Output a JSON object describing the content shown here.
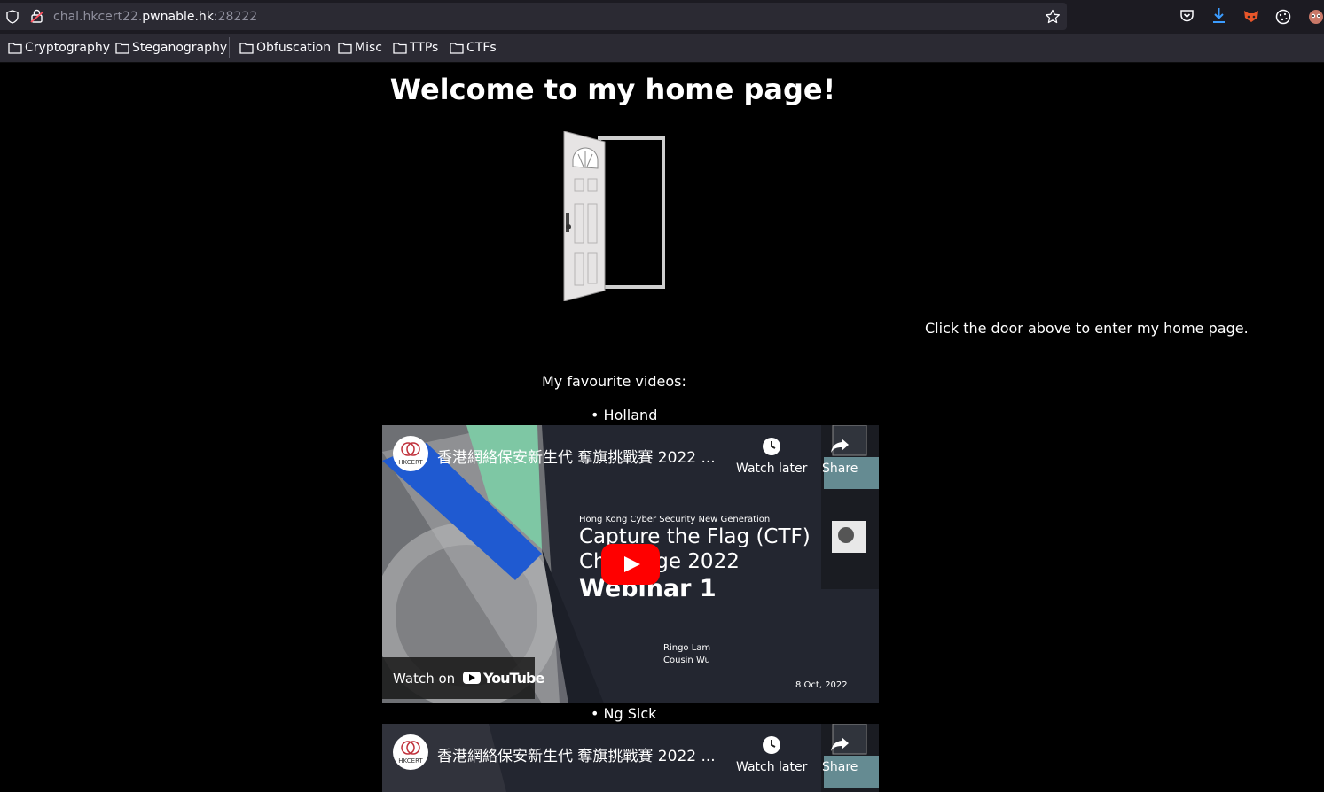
{
  "browser": {
    "url_prefix": "chal.hkcert22.",
    "url_host": "pwnable.hk",
    "url_port": ":28222",
    "bookmarks": [
      "Cryptography",
      "Steganography",
      "Obfuscation",
      "Misc",
      "TTPs",
      "CTFs"
    ]
  },
  "page": {
    "heading": "Welcome to my home page!",
    "door_caption": "Click the door above to enter my home page.",
    "favourites_label": "My favourite videos:",
    "videos": [
      {
        "bullet": "Holland",
        "title": "香港網絡保安新生代 奪旗挑戰賽 2022 ...",
        "channel_logo": "HKCERT",
        "watch_later": "Watch later",
        "share": "Share",
        "thumb_small": "Hong Kong Cyber Security New Generation",
        "thumb_line1": "Capture the Flag (CTF)",
        "thumb_line2": "Challenge 2022",
        "thumb_line3": "Webinar 1",
        "presenter1": "Ringo Lam",
        "presenter2": "Cousin Wu",
        "date": "8 Oct, 2022",
        "watch_on": "Watch on",
        "youtube": "YouTube"
      },
      {
        "bullet": "Ng Sick",
        "title": "香港網絡保安新生代 奪旗挑戰賽 2022 ...",
        "channel_logo": "HKCERT",
        "watch_later": "Watch later",
        "share": "Share"
      }
    ]
  }
}
